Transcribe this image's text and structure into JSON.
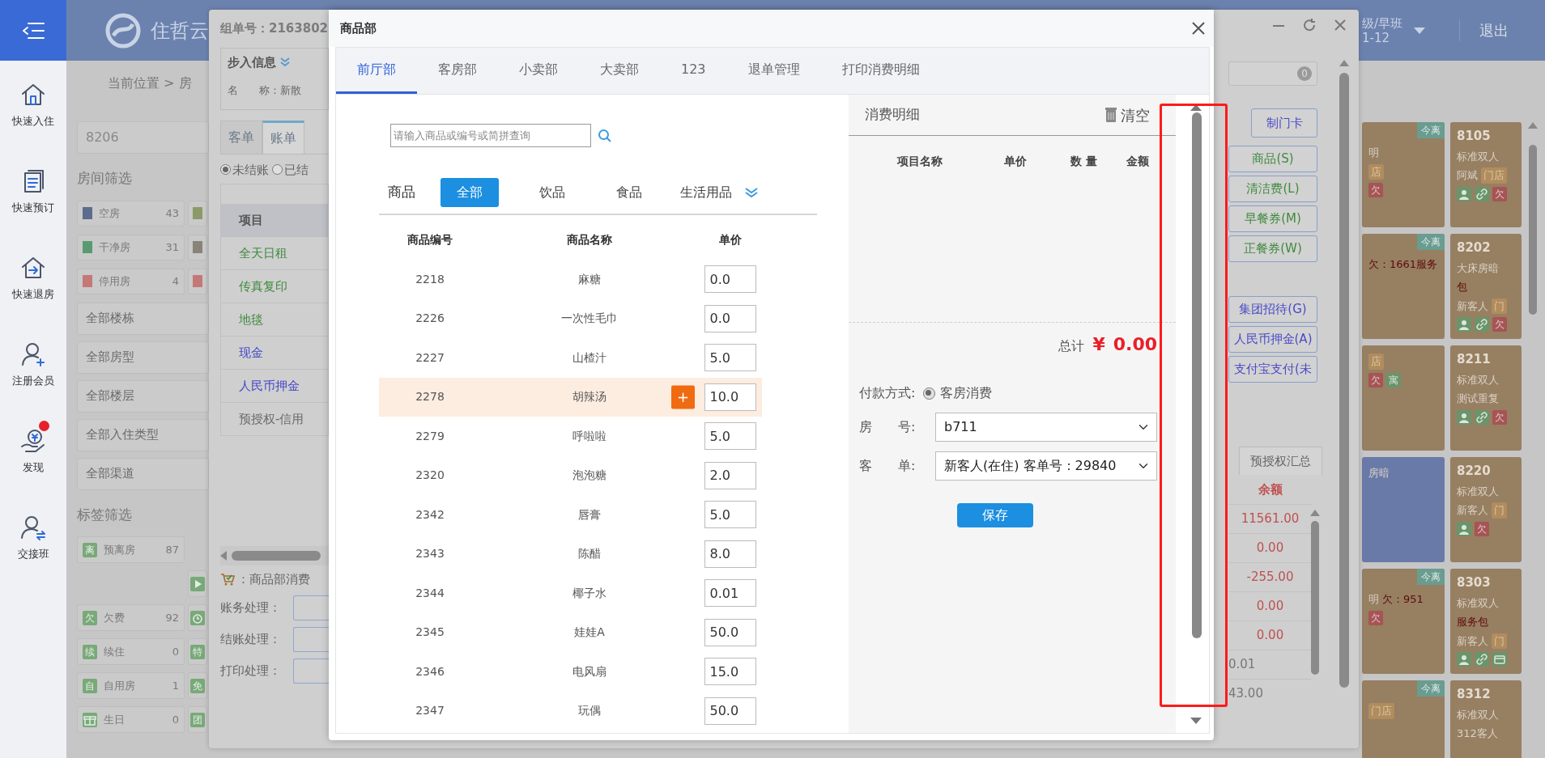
{
  "app_header": {
    "logo_text": "住哲云",
    "shift_text": "级/早班",
    "date_text": "1-12",
    "logout": "退出"
  },
  "sidebar": {
    "items": [
      {
        "label": "快速入住",
        "kind": "home",
        "badge": false
      },
      {
        "label": "快速预订",
        "kind": "doc",
        "badge": false
      },
      {
        "label": "快速退房",
        "kind": "exit",
        "badge": false
      },
      {
        "label": "注册会员",
        "kind": "user-add",
        "badge": false
      },
      {
        "label": "发现",
        "kind": "money",
        "badge": true
      },
      {
        "label": "交接班",
        "kind": "user-swap",
        "badge": false
      }
    ]
  },
  "breadcrumb": "当前位置 > 房",
  "room_search": {
    "value": "8206"
  },
  "room_filter": {
    "title": "房间筛选",
    "rows": [
      {
        "items": [
          {
            "kind": "status",
            "label": "空房",
            "count": "43",
            "color": "#5d6b8c"
          },
          {
            "kind": "swatch",
            "color": "#8c9a6a"
          }
        ]
      },
      {
        "items": [
          {
            "kind": "status",
            "label": "干净房",
            "count": "31",
            "color": "#5a9a70"
          },
          {
            "kind": "swatch",
            "color": "#8a8478"
          }
        ]
      },
      {
        "items": [
          {
            "kind": "status",
            "label": "停用房",
            "count": "4",
            "color": "#c47878"
          },
          {
            "kind": "swatch",
            "color": "#c47878"
          }
        ]
      }
    ]
  },
  "dropdowns": [
    "全部楼栋",
    "全部房型",
    "全部楼层",
    "全部入住类型",
    "全部渠道"
  ],
  "tag_filter": {
    "title": "标签筛选",
    "rows": [
      {
        "items": [
          {
            "kind": "tag",
            "glyph": "离",
            "label": "预离房",
            "count": "87"
          }
        ]
      },
      {
        "items": [
          {
            "kind": "play"
          }
        ]
      },
      {
        "items": [
          {
            "kind": "tag",
            "glyph": "欠",
            "label": "欠费",
            "count": "92"
          },
          {
            "kind": "alarm"
          }
        ]
      },
      {
        "items": [
          {
            "kind": "tag",
            "glyph": "续",
            "label": "续住",
            "count": "0"
          },
          {
            "kind": "mark",
            "glyph": "特"
          }
        ]
      },
      {
        "items": [
          {
            "kind": "tag",
            "glyph": "自",
            "label": "自用房",
            "count": "1"
          },
          {
            "kind": "mark",
            "glyph": "免"
          }
        ]
      },
      {
        "items": [
          {
            "kind": "gift",
            "label": "生日",
            "count": "0"
          },
          {
            "kind": "mark",
            "glyph": "团"
          }
        ]
      }
    ]
  },
  "order_dialog": {
    "group_no": "组单号：2163802",
    "walkin": {
      "title": "步入信息",
      "name_label": "名　　称：",
      "name_value": "新散"
    },
    "tabs": [
      {
        "label": "客单",
        "selected": false
      },
      {
        "label": "账单",
        "selected": true
      }
    ],
    "radios": [
      {
        "label": "未结账",
        "selected": true
      },
      {
        "label": "已结",
        "selected": false
      }
    ],
    "table": {
      "header": "项目",
      "rows": [
        {
          "text": "全天日租",
          "kind": "charge"
        },
        {
          "text": "传真复印",
          "kind": "charge"
        },
        {
          "text": "地毯",
          "kind": "charge"
        },
        {
          "text": "现金",
          "kind": "payment"
        },
        {
          "text": "人民币押金",
          "kind": "payment"
        },
        {
          "text": "预授权-信用",
          "kind": "preauth"
        }
      ]
    },
    "consume_label": "：商品部消费",
    "actions": [
      "账务处理：",
      "结账处理：",
      "打印处理："
    ],
    "search_count": "0",
    "buttons": [
      {
        "label": "制门卡",
        "kind": "blue"
      },
      {
        "label": "商品(S)",
        "kind": "green"
      },
      {
        "label": "清洁费(L)",
        "kind": "green"
      },
      {
        "label": "早餐券(M)",
        "kind": "green"
      },
      {
        "label": "正餐券(W)",
        "kind": "green"
      },
      {
        "label": "集团招待(G)",
        "kind": "blue"
      },
      {
        "label": "人民币押金(A)",
        "kind": "blue"
      },
      {
        "label": "支付宝支付(未",
        "kind": "blue"
      }
    ],
    "summary_tab": "预授权汇总",
    "balance": {
      "header": "余额",
      "rows": [
        {
          "kind": "amount",
          "text": "11561.00"
        },
        {
          "kind": "amount",
          "text": "0.00"
        },
        {
          "kind": "amount",
          "text": "-255.00"
        },
        {
          "kind": "amount",
          "text": "0.00"
        },
        {
          "kind": "amount",
          "text": "0.00"
        },
        {
          "kind": "other",
          "text": "0.01"
        },
        {
          "kind": "other",
          "text": "43.00"
        }
      ]
    }
  },
  "rooms": [
    {
      "color": "#977f62",
      "badge": "今离",
      "lines": [
        [
          {
            "kind": "text",
            "text": "明"
          }
        ],
        [
          {
            "kind": "tag",
            "text": "店"
          }
        ],
        [
          {
            "kind": "owe",
            "text": "欠"
          }
        ]
      ]
    },
    {
      "color": "#977f62",
      "number": "8105",
      "lines": [
        [
          {
            "kind": "text",
            "text": "标准双人"
          }
        ],
        [
          {
            "kind": "text",
            "text": "阿斌"
          },
          {
            "kind": "tag",
            "text": "门店"
          }
        ],
        [
          {
            "kind": "person"
          },
          {
            "kind": "link"
          },
          {
            "kind": "owe",
            "text": "欠"
          }
        ]
      ]
    },
    {
      "color": "#977f62",
      "badge": "今离",
      "lines": [
        [
          {
            "kind": "red",
            "text": "欠：1661服务"
          }
        ]
      ]
    },
    {
      "color": "#977f62",
      "number": "8202",
      "lines": [
        [
          {
            "kind": "text",
            "text": "大床房暗"
          }
        ],
        [
          {
            "kind": "red",
            "text": "包"
          }
        ],
        [
          {
            "kind": "text",
            "text": "新客人"
          },
          {
            "kind": "tag",
            "text": "门"
          }
        ],
        [
          {
            "kind": "person"
          },
          {
            "kind": "link"
          },
          {
            "kind": "owe",
            "text": "欠"
          }
        ]
      ]
    },
    {
      "color": "#977f62",
      "lines": [
        [
          {
            "kind": "tag",
            "text": "店"
          }
        ],
        [
          {
            "kind": "owe",
            "text": "欠"
          },
          {
            "kind": "apt",
            "text": "寓"
          }
        ]
      ]
    },
    {
      "color": "#977f62",
      "number": "8211",
      "lines": [
        [
          {
            "kind": "text",
            "text": "标准双人"
          }
        ],
        [
          {
            "kind": "text",
            "text": "测试重复"
          }
        ],
        [
          {
            "kind": "person"
          },
          {
            "kind": "link"
          },
          {
            "kind": "owe",
            "text": "欠"
          }
        ]
      ]
    },
    {
      "color": "#6a7aa8",
      "lines": [
        [
          {
            "kind": "text",
            "text": "房暗"
          }
        ]
      ]
    },
    {
      "color": "#977f62",
      "number": "8220",
      "lines": [
        [
          {
            "kind": "text",
            "text": "标准双人"
          }
        ],
        [
          {
            "kind": "text",
            "text": "新客人"
          },
          {
            "kind": "tag",
            "text": "门"
          }
        ],
        [
          {
            "kind": "person"
          },
          {
            "kind": "owe",
            "text": "欠"
          }
        ]
      ]
    },
    {
      "color": "#977f62",
      "badge": "今离",
      "lines": [
        [
          {
            "kind": "text",
            "text": "明"
          },
          {
            "kind": "red",
            "text": "欠：951"
          }
        ],
        [
          {
            "kind": "owe",
            "text": "欠"
          }
        ]
      ]
    },
    {
      "color": "#977f62",
      "number": "8303",
      "lines": [
        [
          {
            "kind": "text",
            "text": "标准双人"
          }
        ],
        [
          {
            "kind": "red",
            "text": "服务包"
          }
        ],
        [
          {
            "kind": "text",
            "text": "新客人"
          },
          {
            "kind": "tag",
            "text": "门"
          }
        ],
        [
          {
            "kind": "person"
          },
          {
            "kind": "link"
          },
          {
            "kind": "card"
          }
        ]
      ]
    },
    {
      "color": "#977f62",
      "badge": "今离",
      "lines": [
        [
          {
            "kind": "tag",
            "text": "门店"
          }
        ]
      ]
    },
    {
      "color": "#977f62",
      "number": "8312",
      "lines": [
        [
          {
            "kind": "text",
            "text": "标准双人"
          }
        ],
        [
          {
            "kind": "text",
            "text": "312客人"
          }
        ]
      ]
    }
  ],
  "goods_dialog": {
    "title": "商品部",
    "tabs": [
      {
        "label": "前厅部",
        "selected": true
      },
      {
        "label": "客房部",
        "selected": false
      },
      {
        "label": "小卖部",
        "selected": false
      },
      {
        "label": "大卖部",
        "selected": false
      },
      {
        "label": "123",
        "selected": false
      },
      {
        "label": "退单管理",
        "selected": false
      },
      {
        "label": "打印消费明细",
        "selected": false
      }
    ],
    "search": {
      "placeholder": "请输入商品或编号或简拼查询"
    },
    "category_label": "商品",
    "categories": [
      {
        "label": "全部",
        "selected": true
      },
      {
        "label": "饮品",
        "selected": false
      },
      {
        "label": "食品",
        "selected": false
      },
      {
        "label": "生活用品",
        "selected": false
      }
    ],
    "columns": [
      "商品编号",
      "商品名称",
      "单价"
    ],
    "add_label": "+",
    "rows": [
      {
        "code": "2218",
        "name": "麻糖",
        "price": "0.0",
        "selected": false
      },
      {
        "code": "2226",
        "name": "一次性毛巾",
        "price": "0.0",
        "selected": false
      },
      {
        "code": "2227",
        "name": "山楂汁",
        "price": "5.0",
        "selected": false
      },
      {
        "code": "2278",
        "name": "胡辣汤",
        "price": "10.0",
        "selected": true
      },
      {
        "code": "2279",
        "name": "呼啦啦",
        "price": "5.0",
        "selected": false
      },
      {
        "code": "2320",
        "name": "泡泡糖",
        "price": "2.0",
        "selected": false
      },
      {
        "code": "2342",
        "name": "唇膏",
        "price": "5.0",
        "selected": false
      },
      {
        "code": "2343",
        "name": "陈醋",
        "price": "8.0",
        "selected": false
      },
      {
        "code": "2344",
        "name": "椰子水",
        "price": "0.01",
        "selected": false
      },
      {
        "code": "2345",
        "name": "娃娃A",
        "price": "50.0",
        "selected": false
      },
      {
        "code": "2346",
        "name": "电风扇",
        "price": "15.0",
        "selected": false
      },
      {
        "code": "2347",
        "name": "玩偶",
        "price": "50.0",
        "selected": false
      }
    ],
    "detail": {
      "title": "消费明细",
      "clear": "清空",
      "columns": [
        "项目名称",
        "单价",
        "数 量",
        "金额"
      ],
      "total_label": "总计",
      "currency": "¥",
      "total": "0.00",
      "payment_label": "付款方式:",
      "payment_options": [
        {
          "label": "客房消费",
          "selected": true
        }
      ],
      "room_label": "房　　号:",
      "room_value": "b711",
      "bill_label": "客　　单:",
      "bill_value": "新客人(在住) 客单号：29840",
      "save": "保存"
    }
  },
  "annotations": [
    {
      "kind": "rectangle"
    }
  ]
}
